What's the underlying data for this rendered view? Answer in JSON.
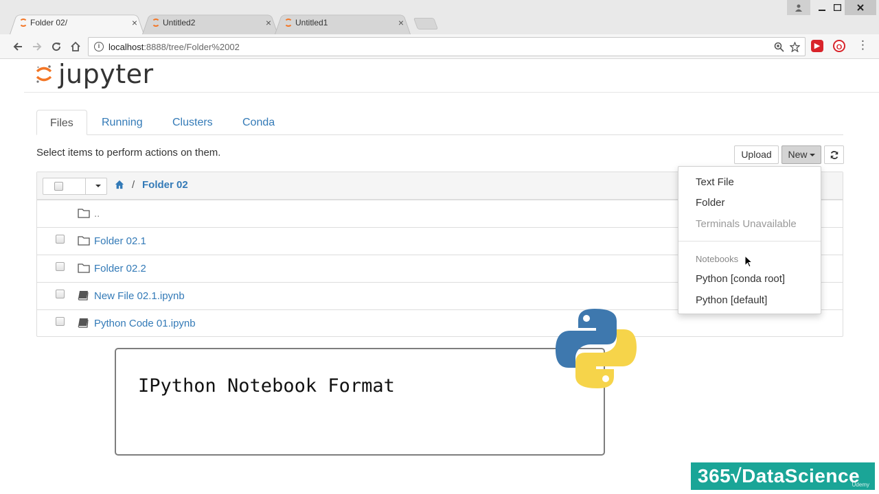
{
  "browser": {
    "tabs": [
      {
        "title": "Folder 02/",
        "active": true
      },
      {
        "title": "Untitled2",
        "active": false
      },
      {
        "title": "Untitled1",
        "active": false
      }
    ],
    "url_host": "localhost",
    "url_path": ":8888/tree/Folder%2002",
    "close_glyph": "×"
  },
  "jupyter": {
    "logo_text": "jupyter",
    "tabs": [
      "Files",
      "Running",
      "Clusters",
      "Conda"
    ],
    "hint": "Select items to perform actions on them.",
    "upload_label": "Upload",
    "new_label": "New",
    "breadcrumb_sep": "/",
    "breadcrumb_folder": "Folder 02",
    "rows": [
      {
        "name": "..",
        "type": "folder",
        "checkbox": false
      },
      {
        "name": "Folder 02.1",
        "type": "folder",
        "checkbox": true
      },
      {
        "name": "Folder 02.2",
        "type": "folder",
        "checkbox": true
      },
      {
        "name": "New File 02.1.ipynb",
        "type": "notebook",
        "checkbox": true
      },
      {
        "name": "Python Code 01.ipynb",
        "type": "notebook",
        "checkbox": true
      }
    ],
    "new_menu": {
      "items": [
        "Text File",
        "Folder"
      ],
      "disabled_item": "Terminals Unavailable",
      "notebooks_header": "Notebooks",
      "notebook_items": [
        "Python [conda root]",
        "Python [default]"
      ]
    }
  },
  "overlay": {
    "caption": "IPython Notebook Format",
    "brand": "365√DataScience",
    "brand_sub": "Udemy"
  },
  "colors": {
    "link": "#337ab7",
    "jupyter_orange": "#f37626",
    "brand_teal": "#1aa597"
  },
  "icons": {
    "back": "arrow-left-icon",
    "forward": "arrow-right-icon",
    "reload": "reload-icon",
    "home": "home-icon",
    "info": "info-icon",
    "zoom": "zoom-icon",
    "bookmark": "star-icon",
    "folder": "folder-icon",
    "notebook": "notebook-icon",
    "refresh": "refresh-icon"
  }
}
